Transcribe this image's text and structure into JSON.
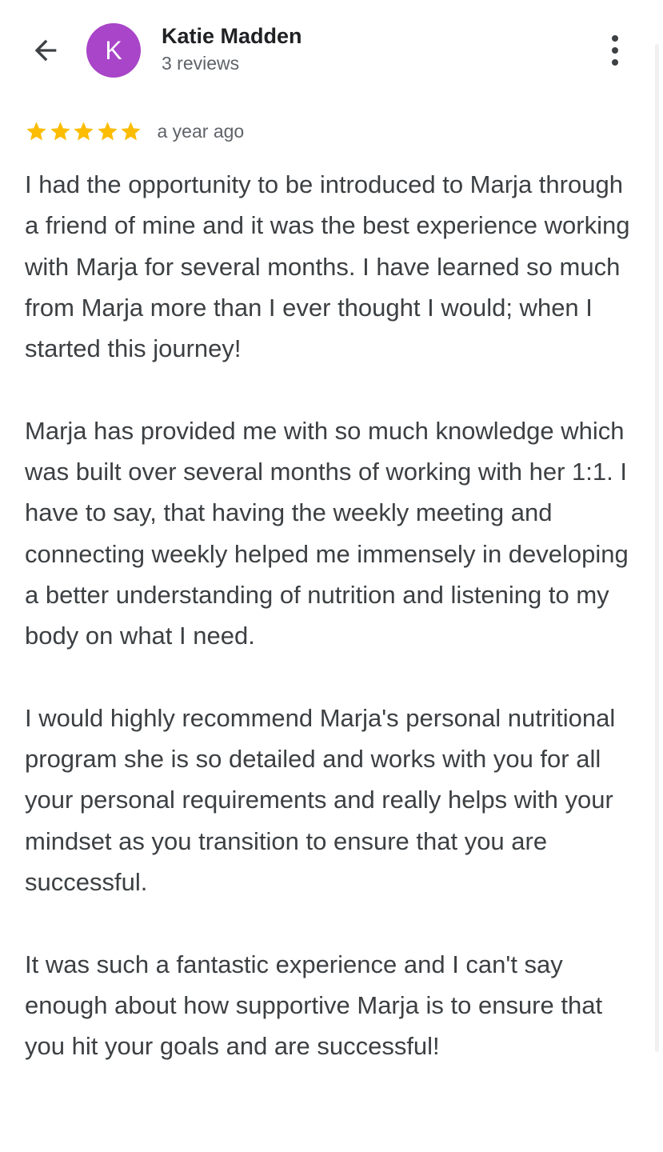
{
  "reviewer": {
    "initial": "K",
    "name": "Katie Madden",
    "review_count": "3 reviews",
    "avatar_color": "#a845c8"
  },
  "review": {
    "rating": 5,
    "star_color": "#fbbc04",
    "time": "a year ago",
    "paragraphs": [
      "I had the opportunity to be introduced to Marja through a friend of mine and it was the best experience working with Marja for several months. I have learned so much from Marja more than I ever thought I would; when I started this journey!",
      "Marja has provided me with so much knowledge which was built over several months of working with her 1:1. I have to say, that having the weekly meeting and connecting weekly helped me immensely in developing a better understanding of nutrition and listening to my body on what I need.",
      "I would highly recommend Marja's personal nutritional program she is so detailed and works with you for all your personal requirements and really helps with your mindset as you transition to ensure that you are successful.",
      "It was such a fantastic experience and I can't say enough about how supportive Marja is to ensure that you hit your goals and are successful!"
    ]
  },
  "icons": {
    "back": "arrow-back-icon",
    "more": "more-vert-icon",
    "star": "star-icon"
  }
}
